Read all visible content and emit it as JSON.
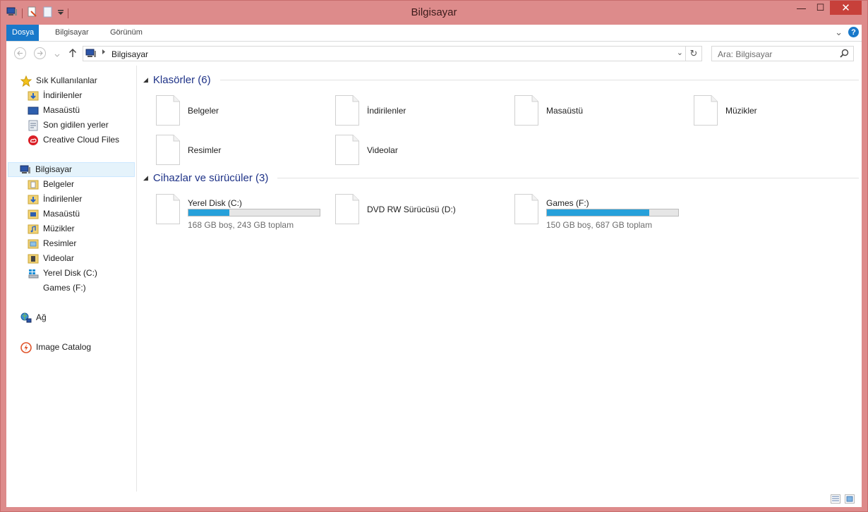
{
  "window": {
    "title": "Bilgisayar"
  },
  "caption": {
    "minimize": "—",
    "maximize": "☐",
    "close": "✕"
  },
  "ribbon": {
    "tabs": [
      "Dosya",
      "Bilgisayar",
      "Görünüm"
    ],
    "expand_glyph": "⌄",
    "help_glyph": "?"
  },
  "address": {
    "path": "Bilgisayar",
    "dropdown_glyph": "⌄",
    "refresh_glyph": "↻"
  },
  "search": {
    "placeholder": "Ara: Bilgisayar"
  },
  "navpane": {
    "favorites": {
      "label": "Sık Kullanılanlar",
      "items": [
        "İndirilenler",
        "Masaüstü",
        "Son gidilen yerler",
        "Creative Cloud Files"
      ]
    },
    "computer": {
      "label": "Bilgisayar",
      "items": [
        "Belgeler",
        "İndirilenler",
        "Masaüstü",
        "Müzikler",
        "Resimler",
        "Videolar",
        "Yerel Disk (C:)",
        "Games (F:)"
      ]
    },
    "network": {
      "label": "Ağ"
    },
    "image_catalog": {
      "label": "Image Catalog"
    }
  },
  "folders_group": {
    "header": "Klasörler (6)",
    "items": [
      "Belgeler",
      "İndirilenler",
      "Masaüstü",
      "Müzikler",
      "Resimler",
      "Videolar"
    ]
  },
  "drives_group": {
    "header": "Cihazlar ve sürücüler (3)",
    "items": [
      {
        "name": "Yerel Disk (C:)",
        "free_text": "168 GB boş, 243 GB toplam",
        "used_fraction": 0.31
      },
      {
        "name": "DVD RW Sürücüsü (D:)"
      },
      {
        "name": "Games (F:)",
        "free_text": "150 GB boş, 687 GB toplam",
        "used_fraction": 0.78
      }
    ]
  },
  "colors": {
    "accent": "#1979ca",
    "bar": "#26a0da",
    "window_frame": "#dd8b8b"
  }
}
